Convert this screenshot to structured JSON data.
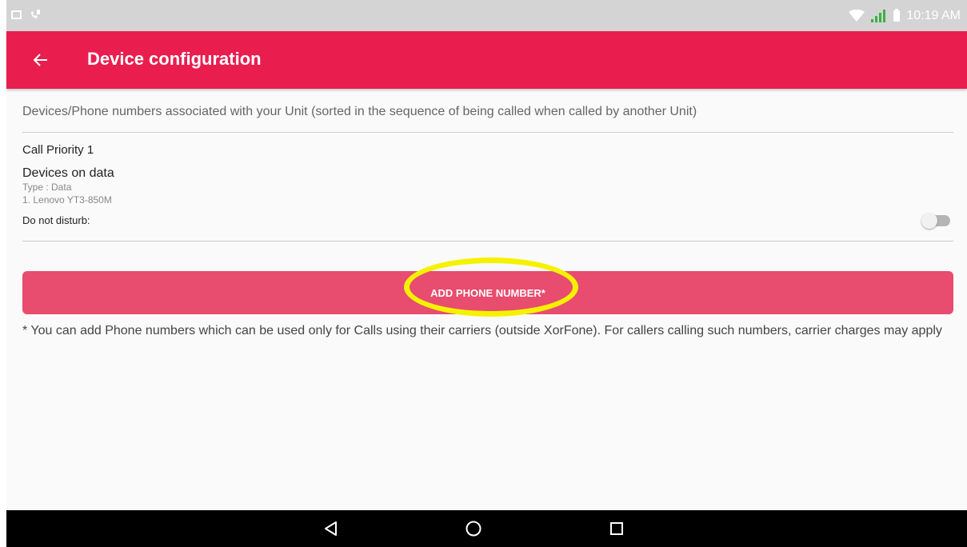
{
  "status_bar": {
    "time": "10:19 AM",
    "icons": [
      "gallery-icon",
      "call-icon",
      "wifi-icon",
      "signal-icon",
      "battery-icon"
    ],
    "signal_color": "#3cb043"
  },
  "app_bar": {
    "title": "Device configuration",
    "back_icon": "arrow-left-icon",
    "color": "#e91e4f"
  },
  "intro_text": "Devices/Phone numbers associated with your Unit (sorted in the sequence of being called when called by another Unit)",
  "call_priority": {
    "label": "Call Priority 1",
    "group_title": "Devices on data",
    "type_line": "Type : Data",
    "device_line": "1. Lenovo YT3-850M",
    "dnd_label": "Do not disturb:",
    "dnd_enabled": false
  },
  "add_button": {
    "label": "ADD PHONE NUMBER*",
    "color": "#e84c6e",
    "highlight_color": "#f5f200"
  },
  "note_text": "* You can add Phone numbers which can be used only for Calls using their carriers (outside XorFone). For callers calling such numbers, carrier charges may apply",
  "nav_bar": {
    "icons": [
      "nav-back-icon",
      "nav-home-icon",
      "nav-recents-icon"
    ]
  }
}
